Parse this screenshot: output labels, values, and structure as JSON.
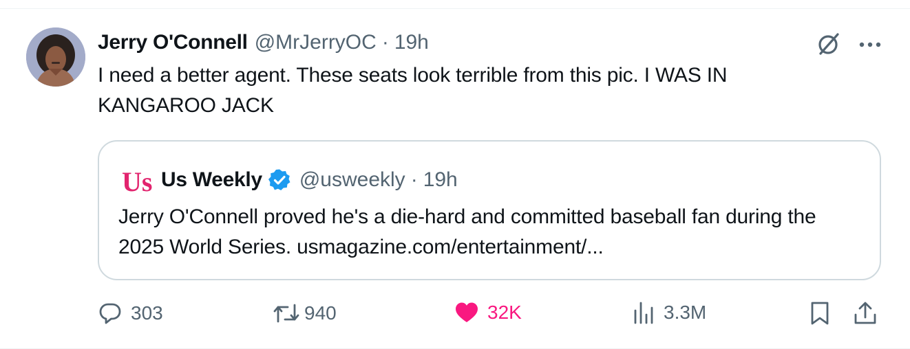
{
  "tweet": {
    "display_name": "Jerry O'Connell",
    "handle": "@MrJerryOC",
    "separator": "·",
    "time": "19h",
    "text": "I need a better agent.  These seats look terrible from this pic.  I WAS IN KANGAROO JACK"
  },
  "quote": {
    "logo_text": "Us",
    "display_name": "Us Weekly",
    "handle": "@usweekly",
    "separator": "·",
    "time": "19h",
    "text": "Jerry O'Connell proved he's a die-hard and committed baseball fan during the 2025 World Series. usmagazine.com/entertainment/..."
  },
  "actions": {
    "replies": "303",
    "reposts": "940",
    "likes": "32K",
    "views": "3.3M"
  },
  "icons": {
    "grok": "grok-icon",
    "more": "more-icon",
    "reply": "reply-icon",
    "repost": "repost-icon",
    "like": "heart-icon",
    "views": "views-icon",
    "bookmark": "bookmark-icon",
    "share": "share-icon",
    "verified": "verified-badge-icon"
  },
  "colors": {
    "text": "#0f1419",
    "secondary": "#536471",
    "like": "#f91880",
    "verified": "#1d9bf0",
    "us_logo": "#e2246e",
    "border": "#cfd9de"
  }
}
